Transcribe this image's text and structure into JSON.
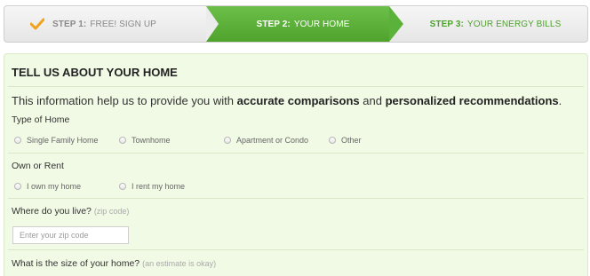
{
  "steps": [
    {
      "number_label": "STEP 1:",
      "title": "FREE! SIGN UP",
      "state": "completed"
    },
    {
      "number_label": "STEP 2:",
      "title": "YOUR HOME",
      "state": "active"
    },
    {
      "number_label": "STEP 3:",
      "title": "YOUR ENERGY BILLS",
      "state": "upcoming"
    }
  ],
  "colors": {
    "accent_green": "#5bb23a",
    "panel_bg": "#f1fae5",
    "check_orange": "#f0a21c"
  },
  "form": {
    "title": "TELL US ABOUT YOUR HOME",
    "intro": {
      "prefix": "This information help us to provide you with ",
      "bold1": "accurate comparisons",
      "middle": " and ",
      "bold2": "personalized recommendations",
      "suffix": "."
    },
    "type_of_home": {
      "label": "Type of Home",
      "options": [
        "Single Family Home",
        "Townhome",
        "Apartment or Condo",
        "Other"
      ]
    },
    "own_or_rent": {
      "label": "Own or Rent",
      "options": [
        "I own my home",
        "I rent my home"
      ]
    },
    "zip": {
      "label": "Where do you live?",
      "hint": "(zip code)",
      "placeholder": "Enter your zip code",
      "value": ""
    },
    "size": {
      "label": "What is the size of your home?",
      "hint": "(an estimate is okay)"
    }
  }
}
